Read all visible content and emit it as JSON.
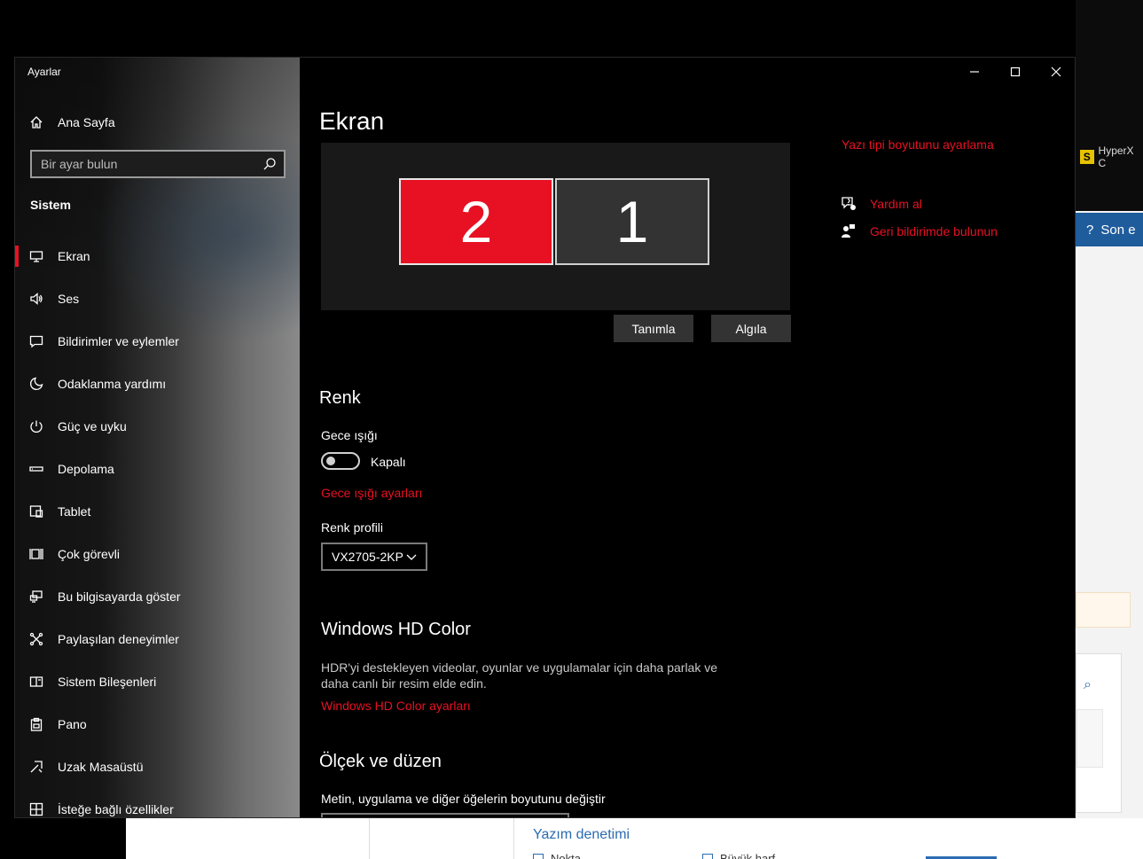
{
  "background": {
    "hyperx_label": "HyperX C",
    "hyperx_badge": "S",
    "son_button_label": "Son e",
    "bottom_title": "Yazım denetimi",
    "bottom_check1": "Nokta",
    "bottom_check2": "Büyük harf"
  },
  "window": {
    "app_title": "Ayarlar"
  },
  "sidebar": {
    "home_label": "Ana Sayfa",
    "search_placeholder": "Bir ayar bulun",
    "section_label": "Sistem",
    "items": [
      {
        "label": "Ekran",
        "icon": "monitor-icon"
      },
      {
        "label": "Ses",
        "icon": "speaker-icon"
      },
      {
        "label": "Bildirimler ve eylemler",
        "icon": "notification-icon"
      },
      {
        "label": "Odaklanma yardımı",
        "icon": "moon-icon"
      },
      {
        "label": "Güç ve uyku",
        "icon": "power-icon"
      },
      {
        "label": "Depolama",
        "icon": "storage-icon"
      },
      {
        "label": "Tablet",
        "icon": "tablet-icon"
      },
      {
        "label": "Çok görevli",
        "icon": "multitask-icon"
      },
      {
        "label": "Bu bilgisayarda göster",
        "icon": "project-icon"
      },
      {
        "label": "Paylaşılan deneyimler",
        "icon": "shared-icon"
      },
      {
        "label": "Sistem Bileşenleri",
        "icon": "components-icon"
      },
      {
        "label": "Pano",
        "icon": "clipboard-icon"
      },
      {
        "label": "Uzak Masaüstü",
        "icon": "remote-icon"
      },
      {
        "label": "İsteğe bağlı özellikler",
        "icon": "optional-features-icon"
      }
    ]
  },
  "content": {
    "page_title": "Ekran",
    "monitors": {
      "left": "2",
      "right": "1"
    },
    "identify_label": "Tanımla",
    "detect_label": "Algıla",
    "color_heading": "Renk",
    "night_light_label": "Gece ışığı",
    "night_light_state": "Kapalı",
    "night_light_settings_link": "Gece ışığı ayarları",
    "color_profile_label": "Renk profili",
    "color_profile_value": "VX2705-2KP",
    "hd_color_heading": "Windows HD Color",
    "hd_color_desc": "HDR'yi destekleyen videolar, oyunlar ve uygulamalar için daha parlak ve daha canlı bir resim elde edin.",
    "hd_color_link": "Windows HD Color ayarları",
    "scale_heading": "Ölçek ve düzen",
    "scale_label": "Metin, uygulama ve diğer öğelerin boyutunu değiştir"
  },
  "related": {
    "font_size_link": "Yazı tipi boyutunu ayarlama",
    "help_link": "Yardım al",
    "feedback_link": "Geri bildirimde bulunun"
  },
  "colors": {
    "accent": "#e81123",
    "monitor_inactive": "#333333",
    "panel_bg": "#191919"
  }
}
